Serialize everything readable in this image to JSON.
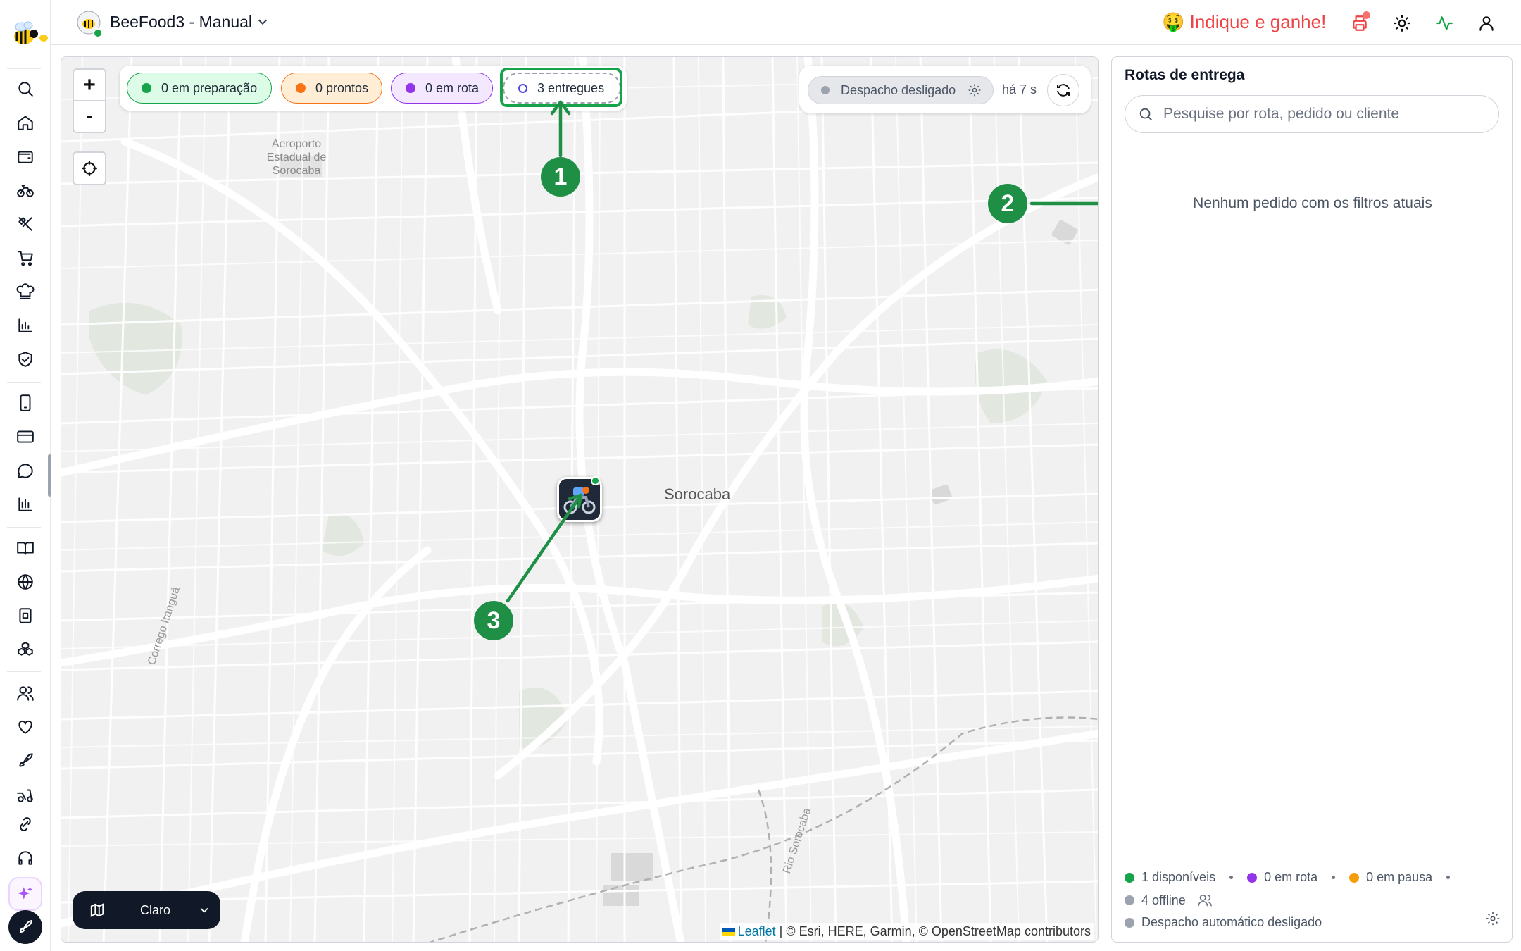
{
  "header": {
    "store_name": "BeeFood3 - Manual",
    "refer_text": "🤑 Indique e ganhe!"
  },
  "sidebar": {
    "icons": [
      "search-icon",
      "home-icon",
      "wallet-icon",
      "bike-icon",
      "utensils-icon",
      "cart-icon",
      "chef-hat-icon",
      "bar-chart-icon",
      "shield-icon",
      "phone-icon",
      "card-icon",
      "chat-icon",
      "chart-icon",
      "book-icon",
      "globe-icon",
      "tablet-icon",
      "boxes-icon",
      "users-icon",
      "heart-icon",
      "rocket-icon",
      "scooter-icon",
      "link-icon",
      "headset-icon",
      "sparkles-icon",
      "rocket-icon"
    ]
  },
  "map": {
    "filters": {
      "preparing": "0 em preparação",
      "ready": "0 prontos",
      "in_route": "0 em rota",
      "delivered": "3 entregues"
    },
    "dispatch_label": "Despacho desligado",
    "dispatch_time": "há 7 s",
    "zoom_in": "+",
    "zoom_out": "-",
    "places": {
      "city": "Sorocaba",
      "airport_line1": "Aeroporto",
      "airport_line2": "Estadual de",
      "airport_line3": "Sorocaba",
      "river1": "Córrego Itanguá",
      "river2": "Rio Sorocaba"
    },
    "theme_label": "Claro",
    "attribution_leaflet": "Leaflet",
    "attribution_rest": " | © Esri, HERE, Garmin, © OpenStreetMap contributors"
  },
  "annotations": {
    "badge1": "1",
    "badge2": "2",
    "badge3": "3",
    "color": "#1f8f46"
  },
  "panel": {
    "title": "Rotas de entrega",
    "search_placeholder": "Pesquise por rota, pedido ou cliente",
    "empty_message": "Nenhum pedido com os filtros atuais",
    "stats": {
      "available": "1 disponíveis",
      "in_route": "0 em rota",
      "paused": "0 em pausa",
      "offline": "4 offline",
      "auto_dispatch": "Despacho automático desligado"
    }
  },
  "colors": {
    "green": "#16a34a",
    "orange": "#f97316",
    "purple": "#9333ea",
    "red": "#ef4444",
    "gray": "#9ca3af"
  }
}
